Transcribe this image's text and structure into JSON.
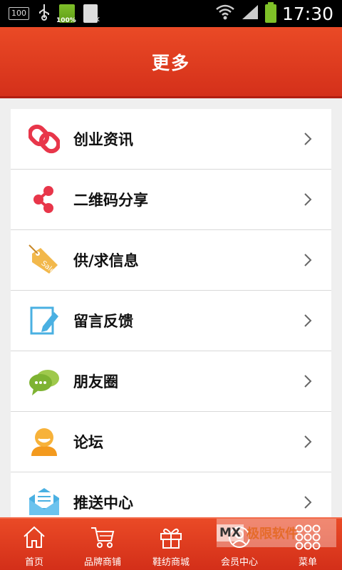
{
  "status_bar": {
    "badge_100": "100",
    "battery_small_label": "100%",
    "time": "17:30"
  },
  "header": {
    "title": "更多"
  },
  "list": [
    {
      "label": "创业资讯",
      "icon": "link-icon"
    },
    {
      "label": "二维码分享",
      "icon": "share-icon"
    },
    {
      "label": "供/求信息",
      "icon": "sale-tag-icon"
    },
    {
      "label": "留言反馈",
      "icon": "edit-note-icon"
    },
    {
      "label": "朋友圈",
      "icon": "chat-bubbles-icon"
    },
    {
      "label": "论坛",
      "icon": "user-avatar-icon"
    },
    {
      "label": "推送中心",
      "icon": "envelope-icon"
    }
  ],
  "bottom_nav": [
    {
      "label": "首页",
      "icon": "home-icon"
    },
    {
      "label": "品牌商铺",
      "icon": "cart-icon"
    },
    {
      "label": "鞋纺商城",
      "icon": "gift-icon"
    },
    {
      "label": "会员中心",
      "icon": "member-icon"
    },
    {
      "label": "菜单",
      "icon": "grid-dots-icon"
    }
  ],
  "watermark": {
    "logo": "MX",
    "text": "极限软件"
  },
  "colors": {
    "accent": "#e23e22",
    "background": "#efefef"
  }
}
